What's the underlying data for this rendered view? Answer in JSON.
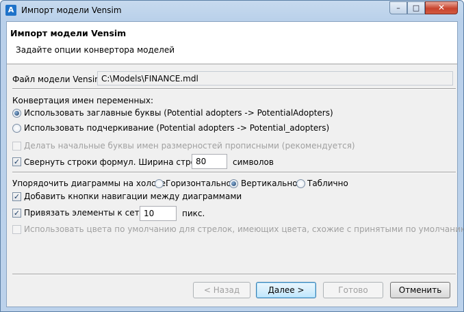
{
  "window": {
    "title": "Импорт модели Vensim",
    "app_icon": "vensim-app-icon",
    "minimize": "–",
    "maximize": "□",
    "close": "✕"
  },
  "header": {
    "title": "Импорт модели Vensim",
    "subtitle": "Задайте опции конвертора моделей"
  },
  "file": {
    "label": "Файл модели Vensim:",
    "value": "C:\\Models\\FINANCE.mdl"
  },
  "naming": {
    "label": "Конвертация имен переменных:",
    "option_capital": "Использовать заглавные буквы (Potential adopters -> PotentialAdopters)",
    "option_underscore": "Использовать подчеркивание (Potential adopters -> Potential_adopters)",
    "selected": "capital"
  },
  "options": {
    "capitalize_dims": {
      "label": "Делать начальные буквы имен размерностей прописными (рекомендуется)",
      "checked": false,
      "enabled": false
    },
    "wrap_lines": {
      "label": "Свернуть строки формул. Ширина строки:",
      "checked": true,
      "value": "80",
      "unit": "символов"
    }
  },
  "diagrams": {
    "label": "Упорядочить диаграммы на холсте:",
    "horizontal": "Горизонтально",
    "vertical": "Вертикально",
    "table": "Таблично",
    "selected": "vertical",
    "nav_buttons": {
      "label": "Добавить кнопки навигации между диаграммами",
      "checked": true
    },
    "snap_grid": {
      "label": "Привязать элементы к сетке:",
      "checked": true,
      "value": "10",
      "unit": "пикс."
    },
    "default_colors": {
      "label": "Использовать цвета по умолчанию для стрелок, имеющих цвета, схожие с принятыми по умолчанию в Vensim",
      "checked": false,
      "enabled": false
    }
  },
  "buttons": {
    "back": "< Назад",
    "next": "Далее >",
    "finish": "Готово",
    "cancel": "Отменить"
  },
  "check_mark": "✓"
}
